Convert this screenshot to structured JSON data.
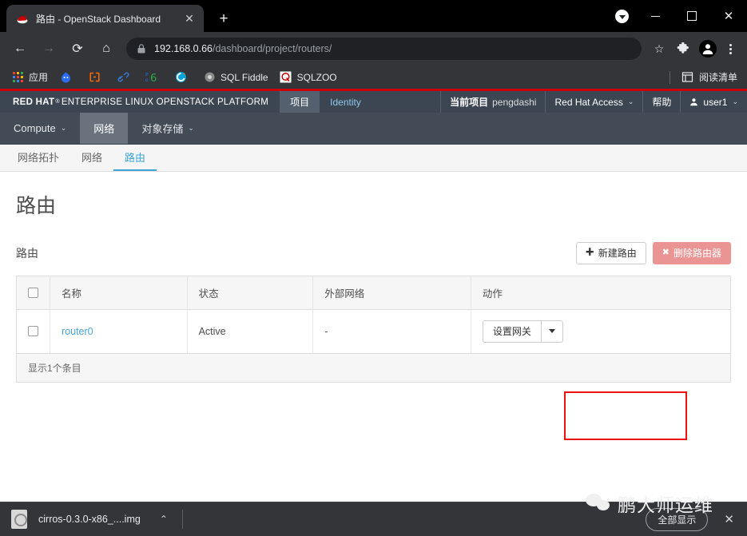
{
  "browser": {
    "tab": {
      "title": "路由 - OpenStack Dashboard",
      "favicon_name": "redhat-favicon",
      "close_glyph": "✕",
      "new_tab_glyph": "+"
    },
    "window_controls": {
      "minimize": "—",
      "maximize": "□",
      "close": "✕"
    },
    "toolbar": {
      "back_glyph": "←",
      "forward_glyph": "→",
      "reload_glyph": "⟳",
      "home_glyph": "⌂",
      "lock_name": "lock-icon",
      "url_host": "192.168.0.66",
      "url_path": "/dashboard/project/routers/",
      "url_full": "192.168.0.66/dashboard/project/routers/",
      "star_glyph": "☆",
      "extensions_name": "extensions-puzzle-icon",
      "profile_name": "profile-avatar",
      "menu_name": "chrome-menu-icon"
    },
    "bookmarks": {
      "items": [
        {
          "label": "应用",
          "icon": "apps-grid-icon"
        },
        {
          "label": "",
          "icon": "blue-droplet-icon"
        },
        {
          "label": "",
          "icon": "orange-bracket-icon"
        },
        {
          "label": "",
          "icon": "blue-link-icon"
        },
        {
          "label": "",
          "icon": "p6-icon"
        },
        {
          "label": "",
          "icon": "green-browser-icon"
        },
        {
          "label": "SQL Fiddle",
          "icon": "sqlfiddle-icon"
        },
        {
          "label": "SQLZOO",
          "icon": "sqlzoo-icon"
        }
      ],
      "reading_list": {
        "label": "阅读清单",
        "icon": "reading-list-icon"
      }
    },
    "download_shelf": {
      "file_name": "cirros-0.3.0-x86_....img",
      "caret_glyph": "⌃",
      "show_all_label": "全部显示",
      "close_glyph": "✕"
    }
  },
  "openstack": {
    "brand": {
      "bold": "RED HAT",
      "reg": "®",
      "rest": "ENTERPRISE LINUX OPENSTACK PLATFORM"
    },
    "top_tabs": [
      {
        "label": "项目",
        "active": true
      },
      {
        "label": "Identity",
        "active": false
      }
    ],
    "top_right": {
      "current_project_label": "当前项目",
      "current_project_name": "pengdashi",
      "red_hat_access": "Red Hat Access",
      "help": "帮助",
      "user": "user1",
      "caret": "⌄"
    },
    "context_nav": [
      {
        "label": "Compute",
        "caret": "⌄",
        "active": false
      },
      {
        "label": "网络",
        "caret": "",
        "active": true
      },
      {
        "label": "对象存储",
        "caret": "⌄",
        "active": false
      }
    ],
    "sub_tabs": [
      {
        "label": "网络拓扑",
        "active": false
      },
      {
        "label": "网络",
        "active": false
      },
      {
        "label": "路由",
        "active": true
      }
    ],
    "page_title": "路由",
    "panel": {
      "title": "路由",
      "create_button": {
        "label": "新建路由",
        "glyph": "✚"
      },
      "delete_button": {
        "label": "删除路由器",
        "glyph": "✖"
      }
    },
    "table": {
      "columns": [
        "名称",
        "状态",
        "外部网络",
        "动作"
      ],
      "rows": [
        {
          "name": "router0",
          "status": "Active",
          "external_network": "-",
          "action_label": "设置网关",
          "action_caret": "▾"
        }
      ],
      "footer": "显示1个条目"
    },
    "colors": {
      "accent_blue": "#3ba7d6",
      "link_blue": "#4ba3d3",
      "red_hat_red": "#cc0000",
      "danger": "#eb9494",
      "annotation_red": "#ee1111",
      "header_dark": "#3c4552",
      "context_bar": "#434b57"
    }
  },
  "watermark": {
    "text": "鹏大师运维",
    "icon": "wechat-icon"
  }
}
